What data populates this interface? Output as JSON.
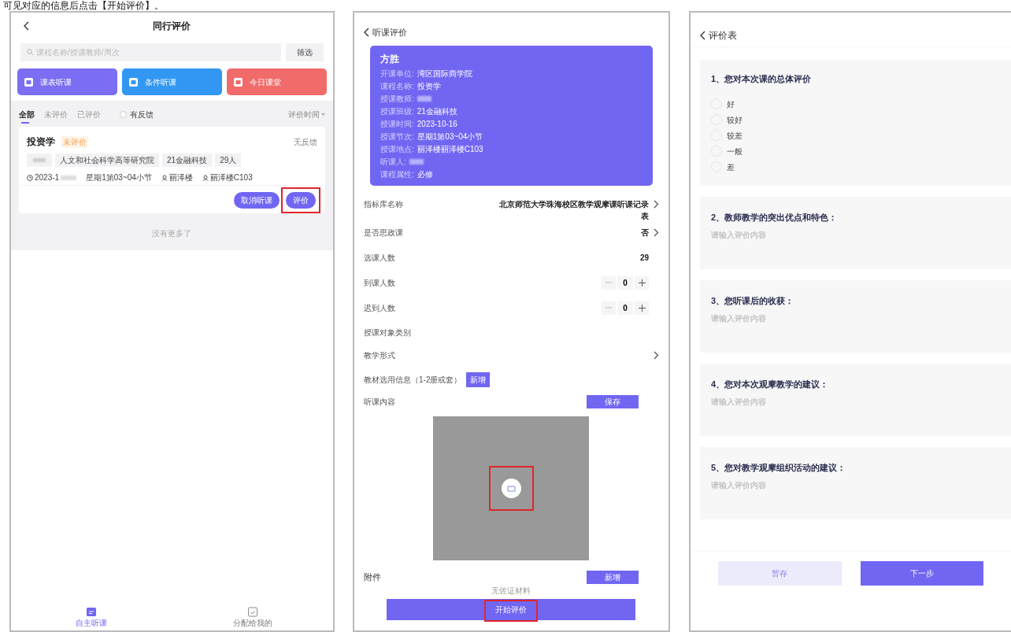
{
  "caption": "可见对应的信息后点击【开始评价】。",
  "list_screen": {
    "title": "同行评价",
    "search": {
      "placeholder": "课程名称/授课教师/周次"
    },
    "filter_button": "筛选",
    "quick_actions": [
      {
        "label": "课表听课",
        "color": "#7b6ef2"
      },
      {
        "label": "条件听课",
        "color": "#3197f3"
      },
      {
        "label": "今日课堂",
        "color": "#f26b6b"
      }
    ],
    "filter_tabs": [
      {
        "label": "全部",
        "selected": true
      },
      {
        "label": "未评价",
        "selected": false
      },
      {
        "label": "已评价",
        "selected": false
      }
    ],
    "feedback_filter": {
      "label": "有反馈",
      "checked": false
    },
    "sort": "评价时间",
    "card": {
      "title": "投资学",
      "status": "未评价",
      "feedback": "无反馈",
      "tags": [
        {
          "redacted": true
        },
        {
          "text": "人文和社会科学高等研究院"
        },
        {
          "text": "21金融科技"
        },
        {
          "text": "29人"
        }
      ],
      "date": "2023-1",
      "period": "星期1第03~04小节",
      "building": "丽泽楼",
      "room": "丽泽楼C103",
      "buttons": [
        {
          "label": "取消听课",
          "highlighted": false
        },
        {
          "label": "评价",
          "highlighted": true
        }
      ]
    },
    "footer": "没有更多了",
    "bottom_nav": [
      {
        "label": "自主听课",
        "selected": true
      },
      {
        "label": "分配给我的",
        "selected": false
      }
    ]
  },
  "detail_screen": {
    "title": "听课评价",
    "info_card": {
      "name": "方胜",
      "fields": [
        {
          "label": "开课单位:",
          "value": "湾区国际商学院"
        },
        {
          "label": "课程名称:",
          "value": "投资学"
        },
        {
          "label": "授课教师:",
          "redacted": true
        },
        {
          "label": "授课班级:",
          "value": "21金融科技"
        },
        {
          "label": "授课时间:",
          "value": "2023-10-16"
        },
        {
          "label": "授课节次:",
          "value": "星期1第03~04小节"
        },
        {
          "label": "授课地点:",
          "value": "丽泽楼丽泽楼C103"
        },
        {
          "label": "听课人:",
          "redacted": true
        },
        {
          "label": "课程属性:",
          "value": "必修"
        }
      ]
    },
    "rows": [
      {
        "kind": "link",
        "label": "指标库名称",
        "value": "北京师范大学珠海校区教学观摩课听课记录表"
      },
      {
        "kind": "link",
        "label": "是否思政课",
        "value": "否"
      },
      {
        "kind": "value",
        "label": "选课人数",
        "value": "29"
      },
      {
        "kind": "stepper",
        "label": "到课人数",
        "value": "0"
      },
      {
        "kind": "stepper",
        "label": "迟到人数",
        "value": "0"
      },
      {
        "kind": "plain",
        "label": "授课对象类别"
      },
      {
        "kind": "link",
        "label": "教学形式"
      },
      {
        "kind": "inline_button",
        "label": "教材选用信息（1-2册或套）",
        "button": "新增"
      },
      {
        "kind": "right_button",
        "label": "听课内容",
        "button": "保存"
      }
    ],
    "content_image": {
      "highlighted": true
    },
    "attachment": {
      "label": "附件",
      "button": "新增",
      "empty": "无佐证材料"
    },
    "start_button": {
      "label": "开始评价",
      "highlighted": true
    }
  },
  "form_screen": {
    "title": "评价表",
    "questions": [
      {
        "kind": "choice",
        "title": "1、您对本次课的总体评价",
        "options": [
          {
            "label": "好",
            "selected": false
          },
          {
            "label": "较好",
            "selected": false
          },
          {
            "label": "较差",
            "selected": false
          },
          {
            "label": "一般",
            "selected": false
          },
          {
            "label": "差",
            "selected": false
          }
        ]
      },
      {
        "kind": "text",
        "title": "2、教师教学的突出优点和特色：",
        "placeholder": "请输入评价内容"
      },
      {
        "kind": "text",
        "title": "3、您听课后的收获：",
        "placeholder": "请输入评价内容"
      },
      {
        "kind": "text",
        "title": "4、您对本次观摩教学的建议：",
        "placeholder": "请输入评价内容"
      },
      {
        "kind": "text",
        "title": "5、您对教学观摩组织活动的建议：",
        "placeholder": "请输入评价内容"
      }
    ],
    "buttons": [
      {
        "kind": "secondary",
        "label": "暂存"
      },
      {
        "kind": "primary",
        "label": "下一步"
      }
    ]
  }
}
